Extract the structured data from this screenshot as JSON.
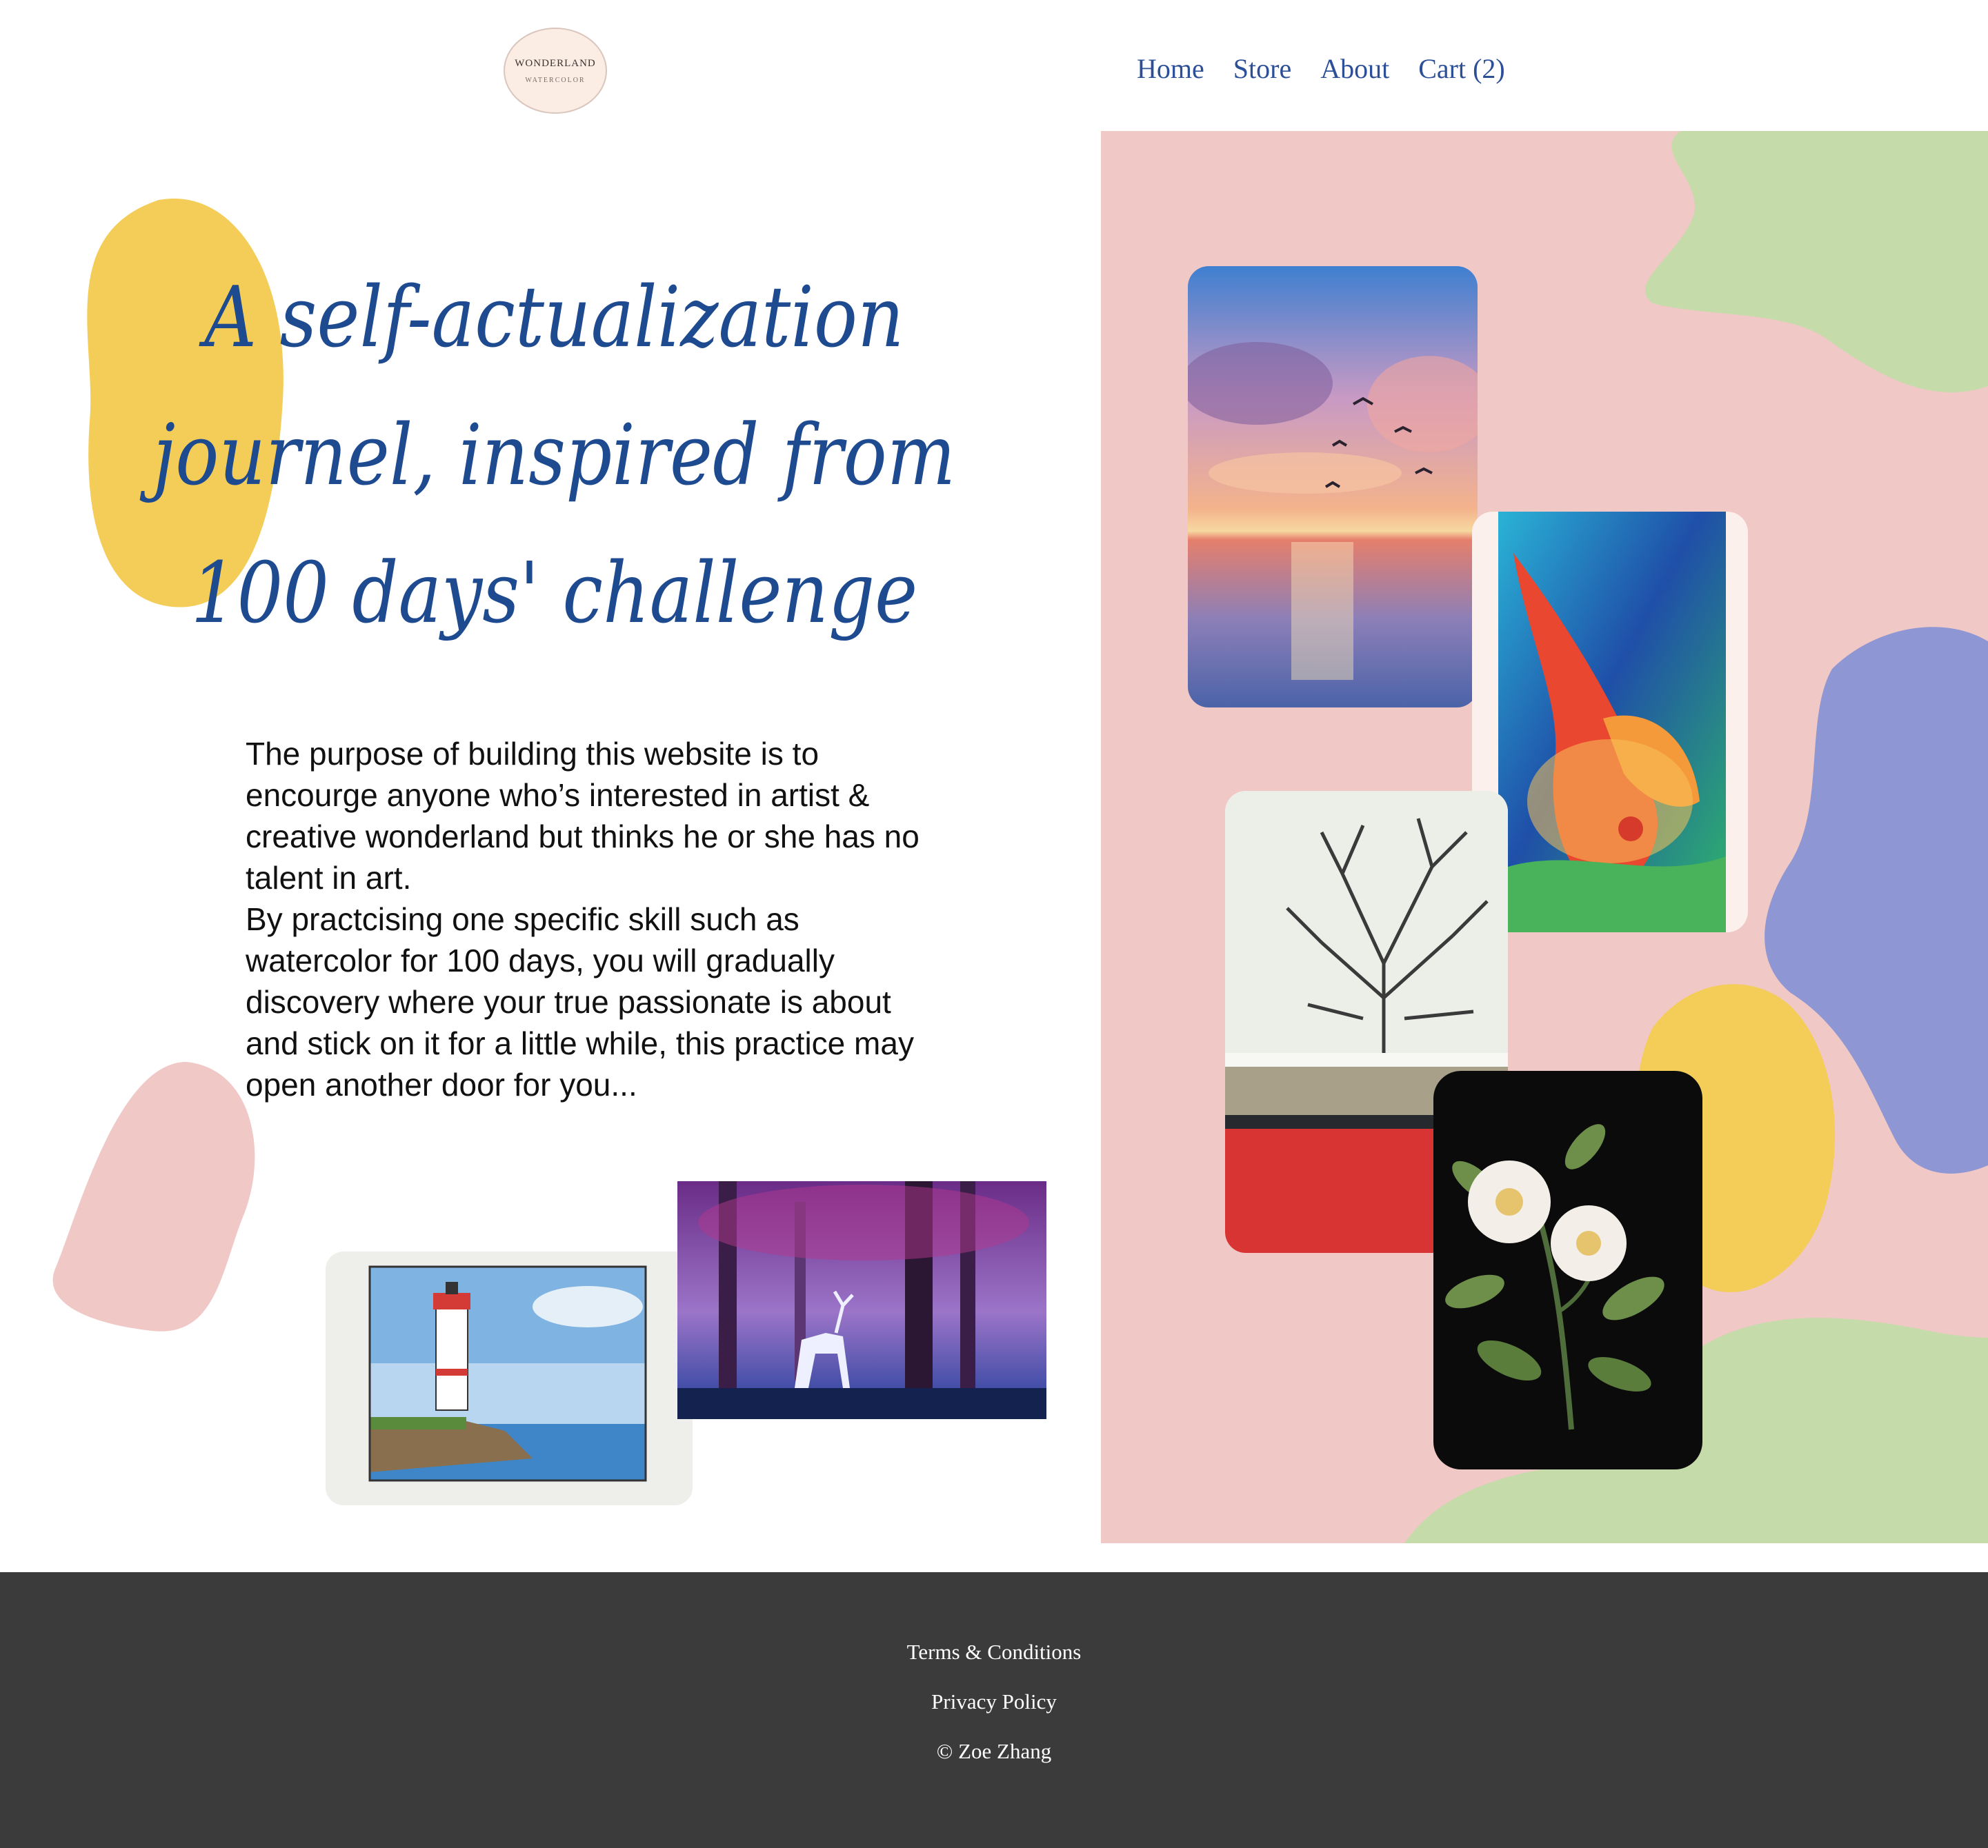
{
  "header": {
    "logo": {
      "line1": "WONDERLAND",
      "line2": "WATERCOLOR"
    },
    "nav": [
      "Home",
      "Store",
      "About",
      "Cart (2)"
    ]
  },
  "hero": {
    "headline": [
      "A self-actualization",
      "journel, inspired from",
      "100 days' challenge"
    ],
    "paragraphs": [
      "The purpose of building this website is to encourge anyone who’s interested in artist & creative wonderland but thinks he or she has no talent in art.",
      "By practcising one specific skill such as watercolor for 100 days, you will gradually discovery where your true passionate is about and stick on it for a little while, this practice may open another door for you..."
    ]
  },
  "colors": {
    "accent_blue": "#1e4a90",
    "nav_blue": "#2c4f98",
    "panel_pink": "#f0c8c6",
    "blob_yellow": "#f4cd58",
    "blob_green": "#c6dbaa",
    "blob_purple": "#8e97d3",
    "footer_bg": "#3b3b3b"
  },
  "footer": {
    "terms": "Terms & Conditions",
    "privacy": "Privacy Policy",
    "copyright": "© Zoe Zhang"
  }
}
